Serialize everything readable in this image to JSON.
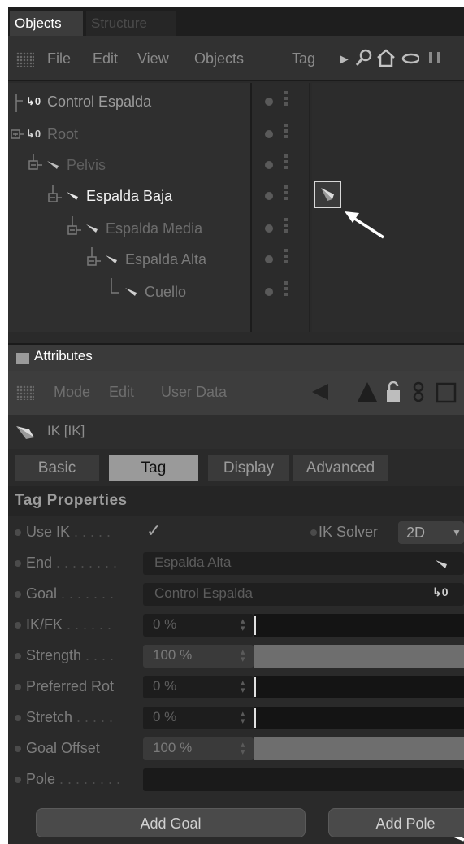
{
  "objects_panel": {
    "tabs": [
      {
        "label": "Objects",
        "active": true
      },
      {
        "label": "Structure",
        "active": false
      }
    ],
    "menu": [
      "File",
      "Edit",
      "View",
      "Objects",
      "Tag"
    ],
    "icons": [
      "search-icon",
      "home-icon",
      "chain-icon",
      "more-icon"
    ],
    "tree": [
      {
        "label": "Control Espalda",
        "icon": "null-object-icon",
        "depth": 0,
        "color": "#9c9c9c"
      },
      {
        "label": "Root",
        "icon": "null-object-icon",
        "depth": 0,
        "color": "#6a6a6a"
      },
      {
        "label": "Pelvis",
        "icon": "joint-icon",
        "depth": 1,
        "color": "#5f5f5f"
      },
      {
        "label": "Espalda Baja",
        "icon": "joint-icon",
        "depth": 2,
        "color": "#f2f2f2",
        "selected": true
      },
      {
        "label": "Espalda Media",
        "icon": "joint-icon",
        "depth": 3,
        "color": "#6c6c6c"
      },
      {
        "label": "Espalda Alta",
        "icon": "joint-icon",
        "depth": 4,
        "color": "#7a7a7a"
      },
      {
        "label": "Cuello",
        "icon": "joint-icon",
        "depth": 5,
        "color": "#7a7a7a"
      }
    ]
  },
  "attributes_panel": {
    "title": "Attributes",
    "menu": [
      "Mode",
      "Edit",
      "User Data"
    ],
    "tools": [
      "back-arrow-icon",
      "up-arrow-icon",
      "lock-icon",
      "link-icon"
    ],
    "object_name": "IK [IK]",
    "tabs": [
      {
        "label": "Basic",
        "active": false
      },
      {
        "label": "Tag",
        "active": true
      },
      {
        "label": "Display",
        "active": false
      },
      {
        "label": "Advanced",
        "active": false
      }
    ],
    "section": "Tag Properties",
    "properties": {
      "use_ik": {
        "label": "Use IK",
        "leader": " . . . . .",
        "checked": true
      },
      "ik_solver": {
        "label": "IK Solver",
        "value": "2D"
      },
      "end": {
        "label": "End",
        "leader": " . . . . . . . .",
        "value": "Espalda Alta"
      },
      "goal": {
        "label": "Goal",
        "leader": " . . . . . . .",
        "value": "Control Espalda"
      },
      "ik_fk": {
        "label": "IK/FK",
        "leader": " . . . . . .",
        "value": "0 %",
        "level": 0
      },
      "strength": {
        "label": "Strength",
        "leader": " . . . .",
        "value": "100 %",
        "level": 1
      },
      "preferred_rot": {
        "label": "Preferred Rot",
        "leader": "",
        "value": "0 %",
        "level": 0
      },
      "stretch": {
        "label": "Stretch",
        "leader": " . . . . .",
        "value": "0 %",
        "level": 0
      },
      "goal_offset": {
        "label": "Goal Offset",
        "leader": "",
        "value": "100 %",
        "level": 1
      },
      "pole": {
        "label": "Pole",
        "leader": " . . . . . . . .",
        "value": ""
      }
    },
    "buttons": {
      "add_goal": "Add Goal",
      "add_pole": "Add Pole"
    }
  },
  "colors": {
    "panel": "#2a2a2a",
    "accent_tab": "#9a9a9a",
    "highlight": "#ffffff"
  }
}
